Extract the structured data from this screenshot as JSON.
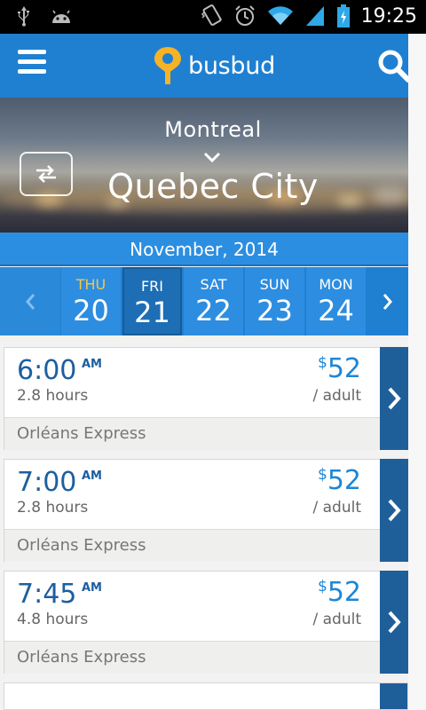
{
  "status_bar": {
    "time": "19:25",
    "icons": [
      "usb-icon",
      "android-icon",
      "vibrate-icon",
      "alarm-icon",
      "wifi-icon",
      "signal-icon",
      "battery-icon"
    ]
  },
  "app_bar": {
    "logo_text": "busbud",
    "menu_icon": "hamburger-menu-icon",
    "search_icon": "search-icon"
  },
  "route": {
    "from": "Montreal",
    "to": "Quebec City",
    "swap_icon": "swap-icon"
  },
  "calendar": {
    "month_label": "November, 2014",
    "days": [
      {
        "dow": "THU",
        "num": "20",
        "state": "past"
      },
      {
        "dow": "FRI",
        "num": "21",
        "state": "selected"
      },
      {
        "dow": "SAT",
        "num": "22",
        "state": "normal"
      },
      {
        "dow": "SUN",
        "num": "23",
        "state": "normal"
      },
      {
        "dow": "MON",
        "num": "24",
        "state": "normal"
      }
    ]
  },
  "trips": [
    {
      "time": "6:00",
      "ampm": "AM",
      "duration": "2.8 hours",
      "currency": "$",
      "price": "52",
      "per": "/ adult",
      "carrier": "Orléans Express"
    },
    {
      "time": "7:00",
      "ampm": "AM",
      "duration": "2.8 hours",
      "currency": "$",
      "price": "52",
      "per": "/ adult",
      "carrier": "Orléans Express"
    },
    {
      "time": "7:45",
      "ampm": "AM",
      "duration": "4.8 hours",
      "currency": "$",
      "price": "52",
      "per": "/ adult",
      "carrier": "Orléans Express"
    }
  ],
  "colors": {
    "brand_blue": "#1f80d1",
    "selected_day": "#1d6eb5",
    "time_text": "#1c5fa0",
    "price_text": "#1e86d6",
    "go_button": "#1f5f99",
    "logo_pin": "#f5b325"
  }
}
